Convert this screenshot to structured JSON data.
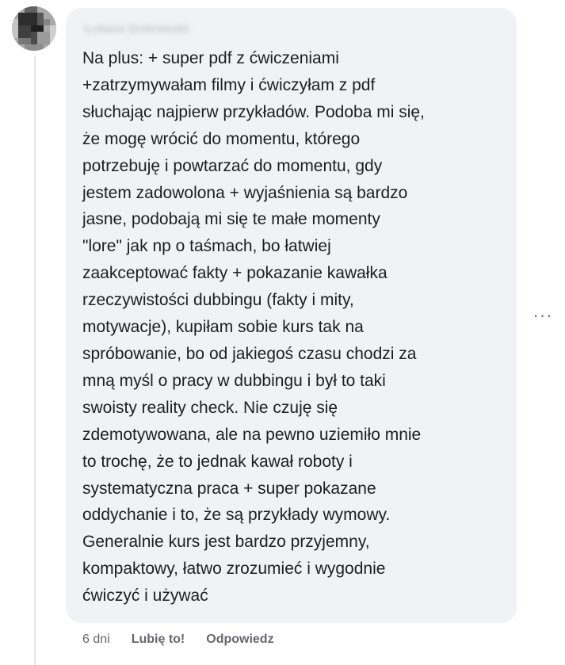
{
  "comment": {
    "author": "Łukasz Dobrowski",
    "text": "Na plus: + super pdf z ćwiczeniami\n+zatrzymywałam filmy i ćwiczyłam z pdf\nsłuchając najpierw przykładów. Podoba mi się,\nże mogę wrócić do momentu, którego\npotrzebuję i powtarzać do momentu, gdy\njestem zadowolona + wyjaśnienia są bardzo\njasne, podobają mi się te małe momenty\n\"lore\" jak np o taśmach, bo łatwiej\nzaakceptować fakty + pokazanie kawałka\nrzeczywistości dubbingu (fakty i mity,\nmotywacje), kupiłam sobie kurs tak na\nspróbowanie, bo od jakiegoś czasu chodzi za\nmną myśl o pracy w dubbingu i był to taki\nswoisty reality check. Nie czuję się\nzdemotywowana, ale na pewno uziemiło mnie\nto trochę, że to jednak kawał roboty i\nsystematyczna praca + super pokazane\noddychanie i to, że są przykłady wymowy.\nGeneralnie kurs jest bardzo przyjemny,\nkompaktowy, łatwo zrozumieć i wygodnie\nćwiczyć i używać"
  },
  "actions": {
    "time": "6 dni",
    "like": "Lubię to!",
    "reply": "Odpowiedz"
  },
  "menu": {
    "more": "···",
    "icon": "more-horizontal-icon"
  },
  "colors": {
    "bubble": "#f0f2f5",
    "text": "#1c1e21",
    "meta": "#65676b"
  }
}
